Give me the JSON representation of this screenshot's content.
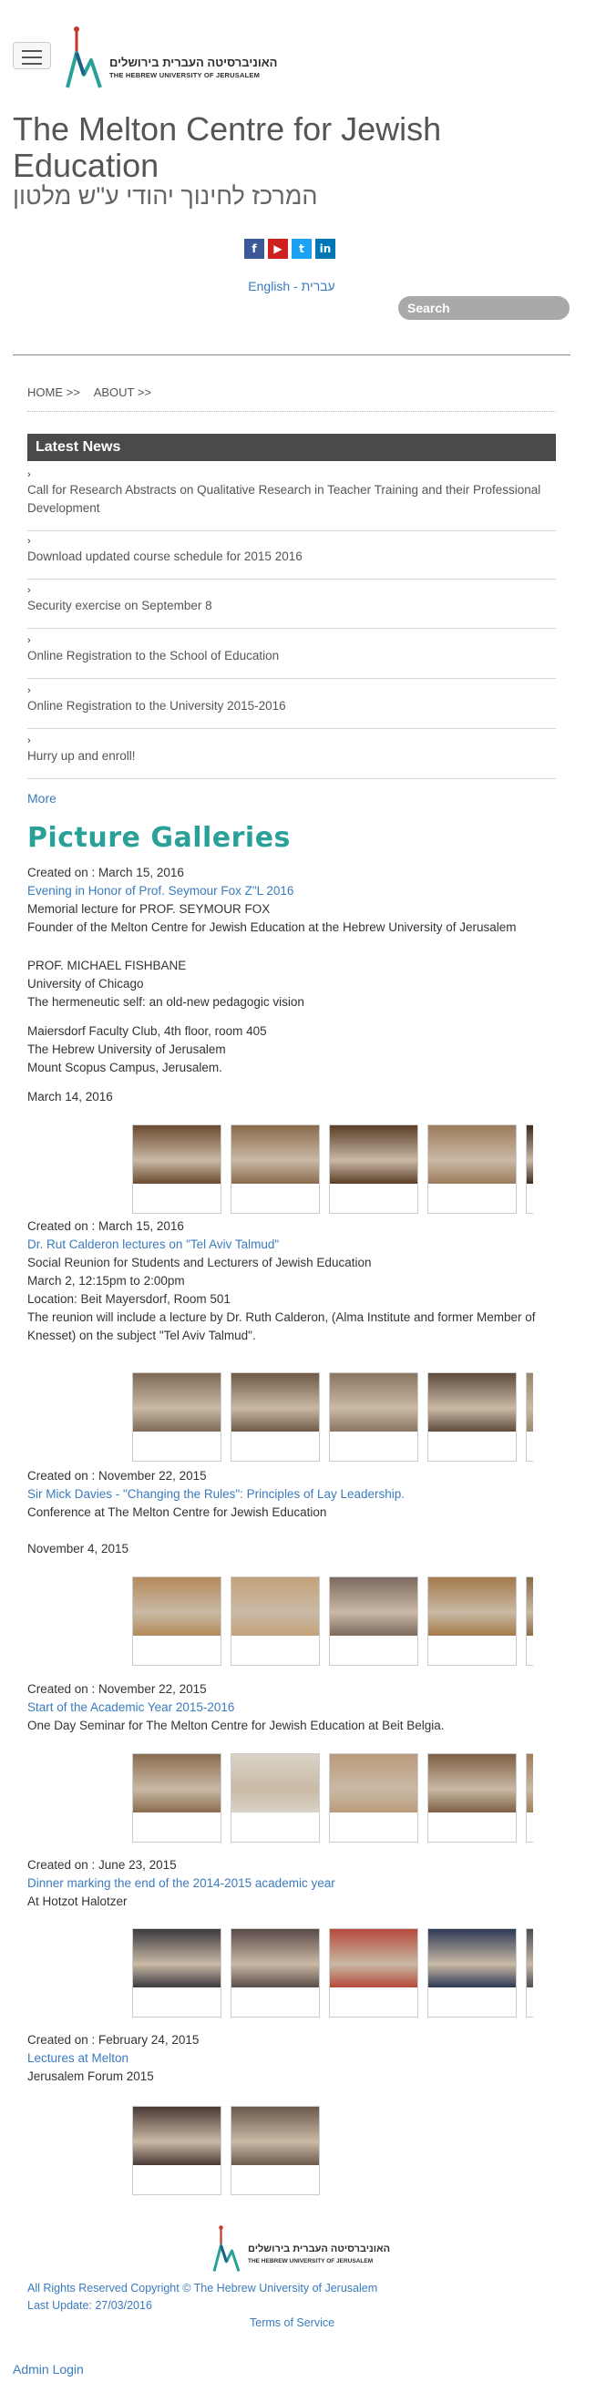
{
  "header": {
    "logo_hebrew": "האוניברסיטה העברית בירושלים",
    "logo_english": "THE HEBREW UNIVERSITY OF JERUSALEM",
    "title": "The Melton Centre for Jewish Education",
    "title_hebrew": "המרכז לחינוך יהודי ע\"ש מלטון",
    "social": [
      {
        "icon": "facebook-icon",
        "glyph": "f",
        "color": "#3b5998"
      },
      {
        "icon": "youtube-icon",
        "glyph": "▶",
        "color": "#cd201f"
      },
      {
        "icon": "twitter-icon",
        "glyph": "t",
        "color": "#1da1f2"
      },
      {
        "icon": "linkedin-icon",
        "glyph": "in",
        "color": "#0077b5"
      }
    ],
    "lang_english": "English",
    "lang_sep": " - ",
    "lang_hebrew": "עברית",
    "search_placeholder": "Search"
  },
  "breadcrumb": [
    "HOME >>",
    "ABOUT >>"
  ],
  "news": {
    "heading": "Latest News",
    "items": [
      "Call for Research Abstracts on Qualitative Research in Teacher Training and their Professional Development",
      "Download updated course schedule for 2015 2016",
      "Security exercise on September 8",
      "Online Registration to the School of Education",
      "Online Registration to the University 2015-2016",
      "Hurry up and enroll!"
    ],
    "more": "More"
  },
  "galleries": {
    "heading": "Picture Galleries",
    "entries": [
      {
        "created": "Created on : March 15, 2016",
        "title": "Evening in Honor of Prof. Seymour Fox Z\"L 2016",
        "lines": [
          "Memorial lecture for PROF. SEYMOUR FOX",
          "Founder of the Melton Centre for Jewish Education at the Hebrew University of Jerusalem",
          "PROF. MICHAEL FISHBANE",
          "University of Chicago",
          "The hermeneutic self: an old-new pedagogic vision",
          "Maiersdorf Faculty Club, 4th floor, room 405",
          "The Hebrew University of Jerusalem",
          "Mount Scopus Campus, Jerusalem.",
          "March 14, 2016"
        ]
      },
      {
        "created": "Created on : March 15, 2016",
        "title": "Dr. Rut Calderon lectures on \"Tel Aviv Talmud\"",
        "lines": [
          "Social Reunion for Students and Lecturers of Jewish Education",
          "March 2, 12:15pm to 2:00pm",
          "Location: Beit Mayersdorf, Room 501",
          "The reunion will include a lecture by Dr. Ruth Calderon, (Alma Institute and former Member of Knesset) on the subject \"Tel Aviv Talmud\"."
        ]
      },
      {
        "created": "Created on : November 22, 2015",
        "title": "Sir Mick Davies - \"Changing the Rules\": Principles of Lay Leadership.",
        "lines": [
          "Conference at The Melton Centre for Jewish Education",
          "November 4, 2015"
        ]
      },
      {
        "created": "Created on : November 22, 2015",
        "title": "Start of the Academic Year 2015-2016",
        "lines": [
          "One Day Seminar for The Melton Centre for Jewish Education at Beit Belgia."
        ]
      },
      {
        "created": "Created on : June 23, 2015",
        "title": "Dinner marking the end of the 2014-2015 academic year",
        "lines": [
          "At Hotzot Halotzer"
        ]
      },
      {
        "created": "Created on : February 24, 2015",
        "title": "Lectures at Melton",
        "lines": [
          "Jerusalem Forum 2015"
        ]
      }
    ]
  },
  "footer": {
    "logo_hebrew": "האוניברסיטה העברית בירושלים",
    "logo_english": "THE HEBREW UNIVERSITY OF JERUSALEM",
    "copyright": "All Rights Reserved Copyright © The Hebrew University of Jerusalem",
    "last_update": "Last Update: 27/03/2016",
    "terms": "Terms of Service",
    "admin": "Admin Login"
  }
}
